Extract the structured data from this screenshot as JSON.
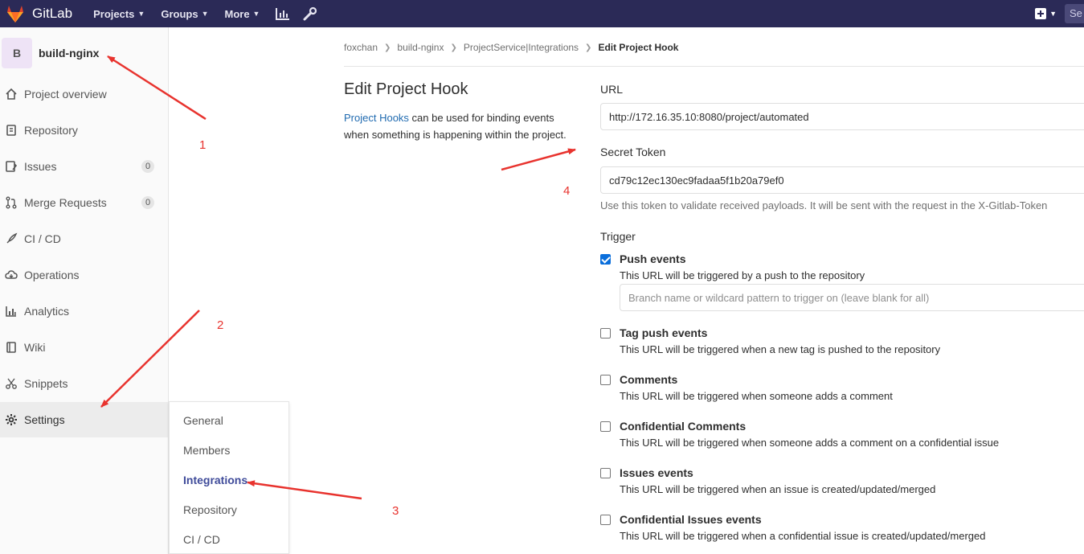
{
  "navbar": {
    "brand": "GitLab",
    "menu": [
      {
        "label": "Projects"
      },
      {
        "label": "Groups"
      },
      {
        "label": "More"
      }
    ],
    "search_stub": "Se"
  },
  "sidebar": {
    "project_avatar": "B",
    "project_name": "build-nginx",
    "items": [
      {
        "label": "Project overview",
        "icon": "home-icon"
      },
      {
        "label": "Repository",
        "icon": "doc-icon"
      },
      {
        "label": "Issues",
        "icon": "issues-icon",
        "count": "0"
      },
      {
        "label": "Merge Requests",
        "icon": "merge-request-icon",
        "count": "0"
      },
      {
        "label": "CI / CD",
        "icon": "rocket-icon"
      },
      {
        "label": "Operations",
        "icon": "cloud-icon"
      },
      {
        "label": "Analytics",
        "icon": "chart-icon"
      },
      {
        "label": "Wiki",
        "icon": "book-icon"
      },
      {
        "label": "Snippets",
        "icon": "scissors-icon"
      },
      {
        "label": "Settings",
        "icon": "gear-icon"
      }
    ]
  },
  "settings_flyout": {
    "items": [
      "General",
      "Members",
      "Integrations",
      "Repository",
      "CI / CD"
    ],
    "active": "Integrations"
  },
  "breadcrumb": [
    "foxchan",
    "build-nginx",
    "ProjectService|Integrations",
    "Edit Project Hook"
  ],
  "page": {
    "title": "Edit Project Hook",
    "desc_link": "Project Hooks",
    "desc_rest": " can be used for binding events when something is happening within the project."
  },
  "form": {
    "url_label": "URL",
    "url_value": "http://172.16.35.10:8080/project/automated",
    "token_label": "Secret Token",
    "token_value": "cd79c12ec130ec9fadaa5f1b20a79ef0",
    "token_help": "Use this token to validate received payloads. It will be sent with the request in the X-Gitlab-Token",
    "trigger_label": "Trigger",
    "branch_placeholder": "Branch name or wildcard pattern to trigger on (leave blank for all)"
  },
  "triggers": [
    {
      "title": "Push events",
      "desc": "This URL will be triggered by a push to the repository",
      "checked": true
    },
    {
      "title": "Tag push events",
      "desc": "This URL will be triggered when a new tag is pushed to the repository",
      "checked": false
    },
    {
      "title": "Comments",
      "desc": "This URL will be triggered when someone adds a comment",
      "checked": false
    },
    {
      "title": "Confidential Comments",
      "desc": "This URL will be triggered when someone adds a comment on a confidential issue",
      "checked": false
    },
    {
      "title": "Issues events",
      "desc": "This URL will be triggered when an issue is created/updated/merged",
      "checked": false
    },
    {
      "title": "Confidential Issues events",
      "desc": "This URL will be triggered when a confidential issue is created/updated/merged",
      "checked": false
    }
  ],
  "annotations": {
    "color": "#e8332e",
    "numbers": [
      "1",
      "2",
      "3",
      "4"
    ]
  }
}
